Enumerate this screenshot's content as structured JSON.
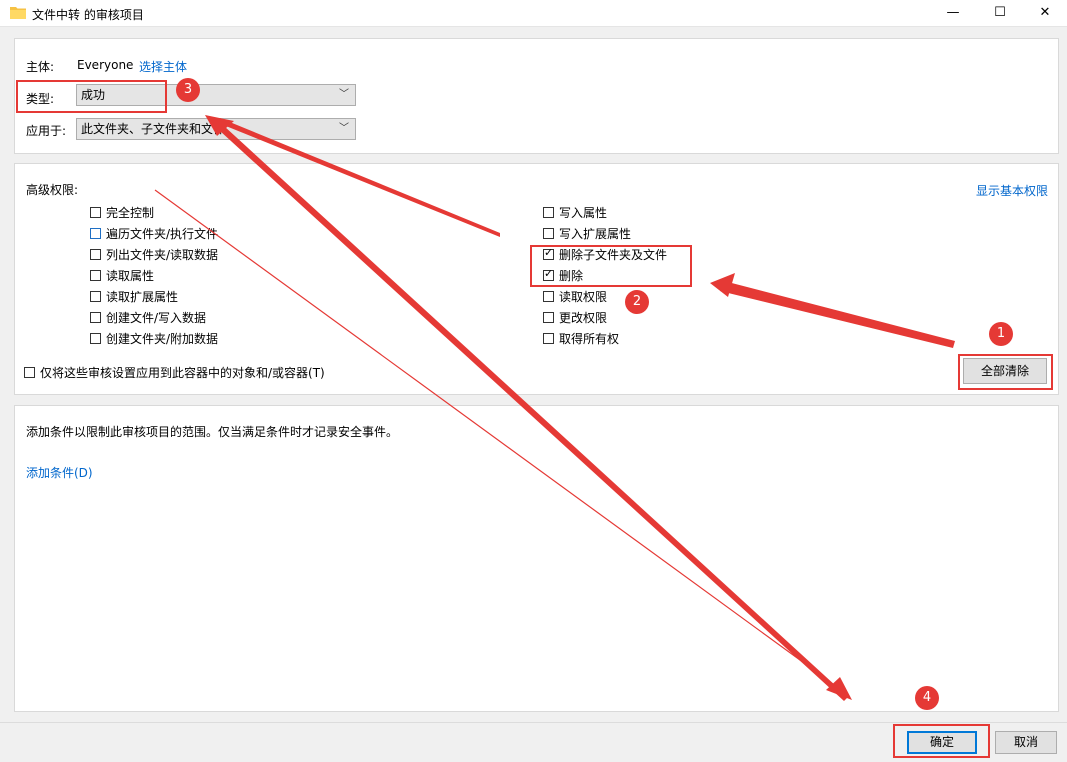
{
  "window": {
    "title": "文件中转 的审核项目",
    "minimize": "—",
    "maximize": "☐",
    "close": "✕"
  },
  "principal": {
    "label": "主体:",
    "value": "Everyone",
    "select_link": "选择主体",
    "type_label": "类型:",
    "type_value": "成功",
    "apply_label": "应用于:",
    "apply_value": "此文件夹、子文件夹和文件"
  },
  "permissions": {
    "header": "高级权限:",
    "show_basic_link": "显示基本权限",
    "left": [
      {
        "label": "完全控制",
        "checked": false
      },
      {
        "label": "遍历文件夹/执行文件",
        "checked": false
      },
      {
        "label": "列出文件夹/读取数据",
        "checked": false
      },
      {
        "label": "读取属性",
        "checked": false
      },
      {
        "label": "读取扩展属性",
        "checked": false
      },
      {
        "label": "创建文件/写入数据",
        "checked": false
      },
      {
        "label": "创建文件夹/附加数据",
        "checked": false
      }
    ],
    "right": [
      {
        "label": "写入属性",
        "checked": false
      },
      {
        "label": "写入扩展属性",
        "checked": false
      },
      {
        "label": "删除子文件夹及文件",
        "checked": true
      },
      {
        "label": "删除",
        "checked": true
      },
      {
        "label": "读取权限",
        "checked": false
      },
      {
        "label": "更改权限",
        "checked": false
      },
      {
        "label": "取得所有权",
        "checked": false
      }
    ],
    "apply_only": "仅将这些审核设置应用到此容器中的对象和/或容器(T)",
    "clear_all": "全部清除"
  },
  "condition": {
    "description": "添加条件以限制此审核项目的范围。仅当满足条件时才记录安全事件。",
    "add_link": "添加条件(D)"
  },
  "footer": {
    "ok": "确定",
    "cancel": "取消"
  },
  "annotations": {
    "badges": [
      "1",
      "2",
      "3",
      "4"
    ],
    "color": "#e53935"
  }
}
